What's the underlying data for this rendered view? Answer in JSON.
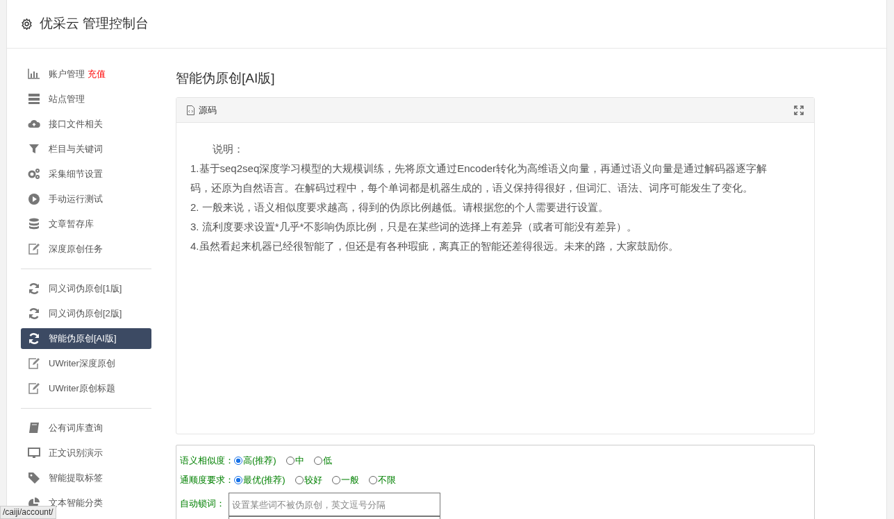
{
  "header": {
    "title": "优采云 管理控制台"
  },
  "sidebar": {
    "groups": [
      {
        "items": [
          {
            "label": "账户管理",
            "badge": "充值",
            "kind": "chart",
            "selected": false
          },
          {
            "label": "站点管理",
            "kind": "server",
            "selected": false
          },
          {
            "label": "接口文件相关",
            "kind": "cloud",
            "selected": false
          },
          {
            "label": "栏目与关键词",
            "kind": "filter",
            "selected": false
          },
          {
            "label": "采集细节设置",
            "kind": "gears",
            "selected": false
          },
          {
            "label": "手动运行测试",
            "kind": "play",
            "selected": false
          },
          {
            "label": "文章暂存库",
            "kind": "database",
            "selected": false
          },
          {
            "label": "深度原创任务",
            "kind": "edit",
            "selected": false
          }
        ]
      },
      {
        "items": [
          {
            "label": "同义词伪原创[1版]",
            "kind": "refresh",
            "selected": false
          },
          {
            "label": "同义词伪原创[2版]",
            "kind": "refresh",
            "selected": false
          },
          {
            "label": "智能伪原创[AI版]",
            "kind": "refresh",
            "selected": true
          },
          {
            "label": "UWriter深度原创",
            "kind": "edit",
            "selected": false
          },
          {
            "label": "UWriter原创标题",
            "kind": "edit",
            "selected": false
          }
        ]
      },
      {
        "items": [
          {
            "label": "公有词库查询",
            "kind": "book",
            "selected": false
          },
          {
            "label": "正文识别演示",
            "kind": "monitor",
            "selected": false
          },
          {
            "label": "智能提取标签",
            "kind": "tag",
            "selected": false
          },
          {
            "label": "文本智能分类",
            "kind": "pie",
            "selected": false
          }
        ]
      }
    ]
  },
  "main": {
    "title": "智能伪原创[AI版]",
    "editor": {
      "tab": "源码",
      "lines": [
        "说明：",
        "1.基于seq2seq深度学习模型的大规模训练，先将原文通过Encoder转化为高维语义向量，再通过语义向量是通过解码器逐字解码，还原为自然语言。在解码过程中，每个单词都是机器生成的，语义保持得很好，但词汇、语法、词序可能发生了变化。",
        "2. 一般来说，语义相似度要求越高，得到的伪原比例越低。请根据您的个人需要进行设置。",
        "3. 流利度要求设置*几乎*不影响伪原比例，只是在某些词的选择上有差异（或者可能没有差异）。",
        "4.虽然看起来机器已经很智能了，但还是有各种瑕疵，离真正的智能还差得很远。未来的路，大家鼓励你。"
      ]
    },
    "options": [
      {
        "label": "语义相似度：",
        "choices": [
          {
            "label": "高(推荐)",
            "selected": true
          },
          {
            "label": "中",
            "selected": false
          },
          {
            "label": "低",
            "selected": false
          }
        ]
      },
      {
        "label": "通顺度要求：",
        "choices": [
          {
            "label": "最优(推荐)",
            "selected": true
          },
          {
            "label": "较好",
            "selected": false
          },
          {
            "label": "一般",
            "selected": false
          },
          {
            "label": "不限",
            "selected": false
          }
        ]
      }
    ],
    "lock": {
      "label": "自动锁词：",
      "placeholder": "设置某些词不被伪原创，英文逗号分隔"
    }
  },
  "status_bar": {
    "url": "/caiji/account/"
  }
}
